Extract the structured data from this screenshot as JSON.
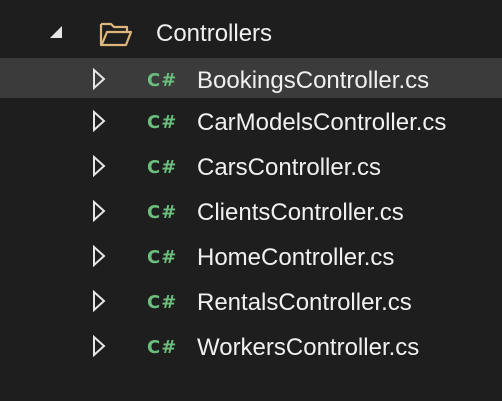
{
  "folder": {
    "label": "Controllers",
    "expand_icon": "expanded-triangle-icon",
    "icon": "open-folder-icon"
  },
  "files": [
    {
      "label": "BookingsController.cs",
      "lang": "C#",
      "selected": true
    },
    {
      "label": "CarModelsController.cs",
      "lang": "C#",
      "selected": false
    },
    {
      "label": "CarsController.cs",
      "lang": "C#",
      "selected": false
    },
    {
      "label": "ClientsController.cs",
      "lang": "C#",
      "selected": false
    },
    {
      "label": "HomeController.cs",
      "lang": "C#",
      "selected": false
    },
    {
      "label": "RentalsController.cs",
      "lang": "C#",
      "selected": false
    },
    {
      "label": "WorkersController.cs",
      "lang": "C#",
      "selected": false
    }
  ],
  "colors": {
    "background": "#1e1e1e",
    "selected_row": "#3b3b3b",
    "text": "#f0f0f0",
    "csharp_icon": "#6bbf7d",
    "folder_icon": "#dcb67a"
  }
}
